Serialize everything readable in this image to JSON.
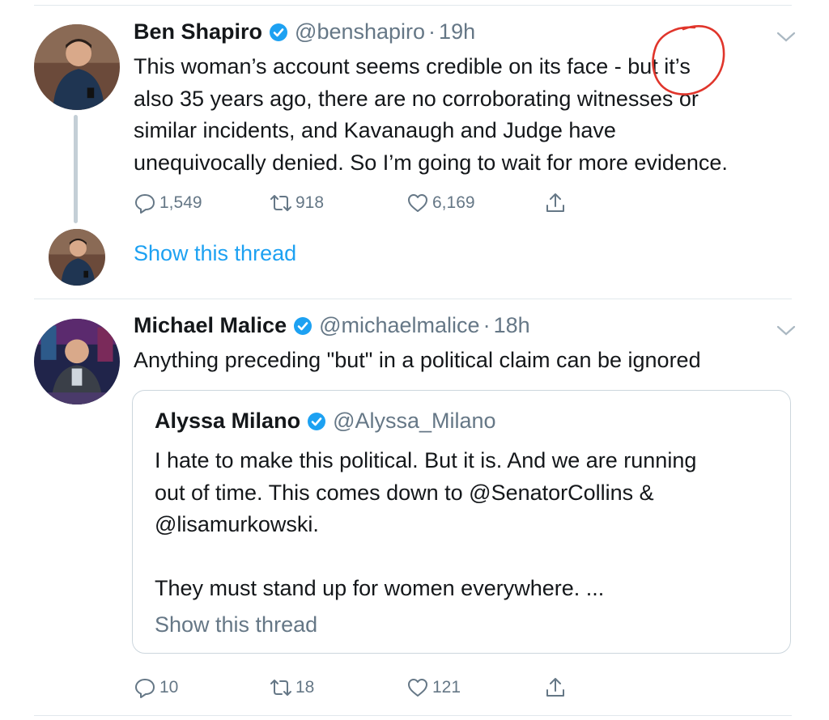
{
  "colors": {
    "link": "#1da1f2",
    "secondary": "#657786",
    "verified": "#1da1f2",
    "annotation": "#e0352b"
  },
  "tweets": [
    {
      "name": "Ben Shapiro",
      "handle": "@benshapiro",
      "dot": "·",
      "time": "19h",
      "text": "This woman’s account seems credible on its face - but it’s\nalso 35 years ago, there are no corroborating witnesses or\nsimilar incidents, and Kavanaugh and Judge have\nunequivocally denied. So I’m going to wait for more evidence.",
      "replies": "1,549",
      "retweets": "918",
      "likes": "6,169",
      "show_thread": "Show this thread"
    },
    {
      "name": "Michael Malice",
      "handle": "@michaelmalice",
      "dot": "·",
      "time": "18h",
      "text": "Anything preceding \"but\" in a political claim can be ignored",
      "replies": "10",
      "retweets": "18",
      "likes": "121",
      "quote": {
        "name": "Alyssa Milano",
        "handle": "@Alyssa_Milano",
        "text": "I hate to make this political. But it is. And we are running\nout of time. This comes down to @SenatorCollins &\n@lisamurkowski.\n\nThey must stand up for women everywhere. ...",
        "show_thread": "Show this thread"
      }
    }
  ],
  "icons": [
    "verified-badge-icon",
    "chevron-down-icon",
    "reply-icon",
    "retweet-icon",
    "like-icon",
    "share-icon"
  ]
}
